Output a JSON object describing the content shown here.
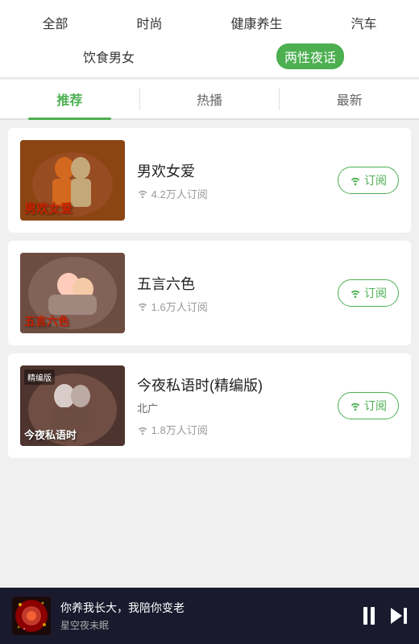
{
  "categories": {
    "row1": [
      {
        "id": "all",
        "label": "全部",
        "active": false
      },
      {
        "id": "fashion",
        "label": "时尚",
        "active": false
      },
      {
        "id": "health",
        "label": "健康养生",
        "active": false
      },
      {
        "id": "car",
        "label": "汽车",
        "active": false
      }
    ],
    "row2": [
      {
        "id": "food",
        "label": "饮食男女",
        "active": false
      },
      {
        "id": "night",
        "label": "两性夜话",
        "active": true
      }
    ]
  },
  "subtabs": [
    {
      "id": "recommended",
      "label": "推荐",
      "active": true
    },
    {
      "id": "hot",
      "label": "热播",
      "active": false
    },
    {
      "id": "latest",
      "label": "最新",
      "active": false
    }
  ],
  "cards": [
    {
      "id": "card1",
      "title": "男欢女爱",
      "thumb_text": "男欢女爱",
      "subscribers": "4.2万人订阅",
      "subscribe_label": "订阅"
    },
    {
      "id": "card2",
      "title": "五言六色",
      "thumb_text": "五言六色",
      "subscribers": "1.6万人订阅",
      "subscribe_label": "订阅"
    },
    {
      "id": "card3",
      "title": "今夜私语时(精编版)",
      "subtitle": "北广",
      "thumb_text": "今夜私语时",
      "thumb_label": "精编版",
      "subscribers": "1.8万人订阅",
      "subscribe_label": "订阅"
    }
  ],
  "player": {
    "title": "你养我长大，我陪你变老",
    "subtitle": "星空夜未眠"
  }
}
